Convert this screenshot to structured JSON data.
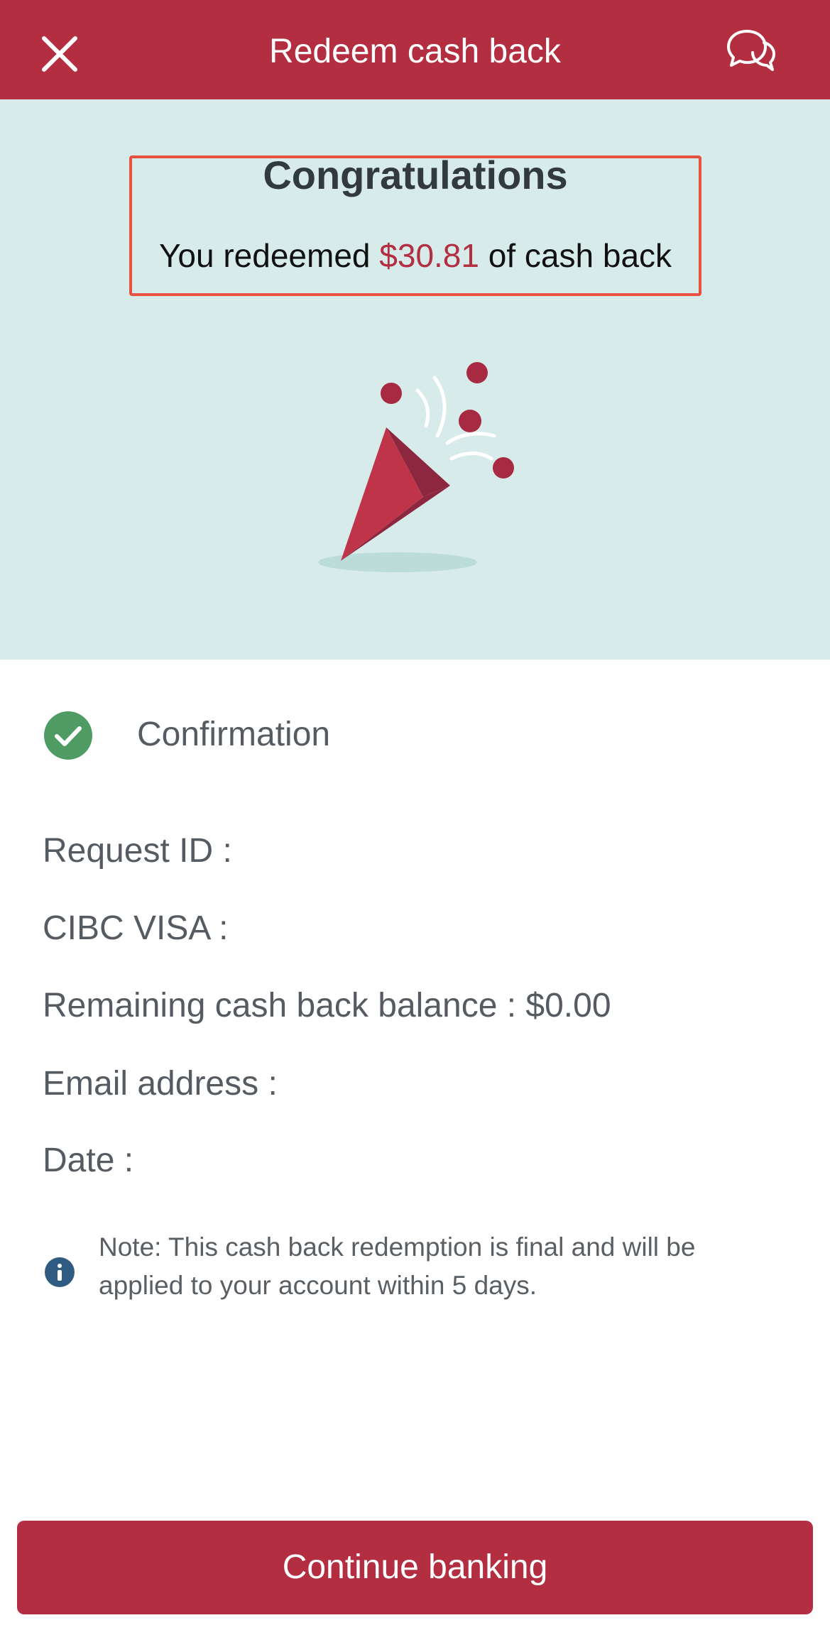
{
  "header": {
    "title": "Redeem cash back",
    "close_icon": "close-icon",
    "chat_icon": "chat-bubbles-icon",
    "background": "#b22e40"
  },
  "hero": {
    "background": "#d7ebeb",
    "heading": "Congratulations",
    "message_prefix": "You redeemed ",
    "amount": "$30.81",
    "message_suffix": " of cash back",
    "illustration": "party-popper-icon"
  },
  "confirmation": {
    "icon": "check-circle-icon",
    "label": "Confirmation",
    "request_id_label": "Request ID :",
    "card_label": "CIBC VISA :",
    "balance_label": "Remaining cash back balance : $0.00",
    "email_label": "Email address :",
    "date_label": "Date :"
  },
  "note": {
    "icon": "info-icon",
    "text": "Note: This cash back redemption is final and will be applied to your account within 5 days."
  },
  "actions": {
    "continue_label": "Continue banking"
  }
}
